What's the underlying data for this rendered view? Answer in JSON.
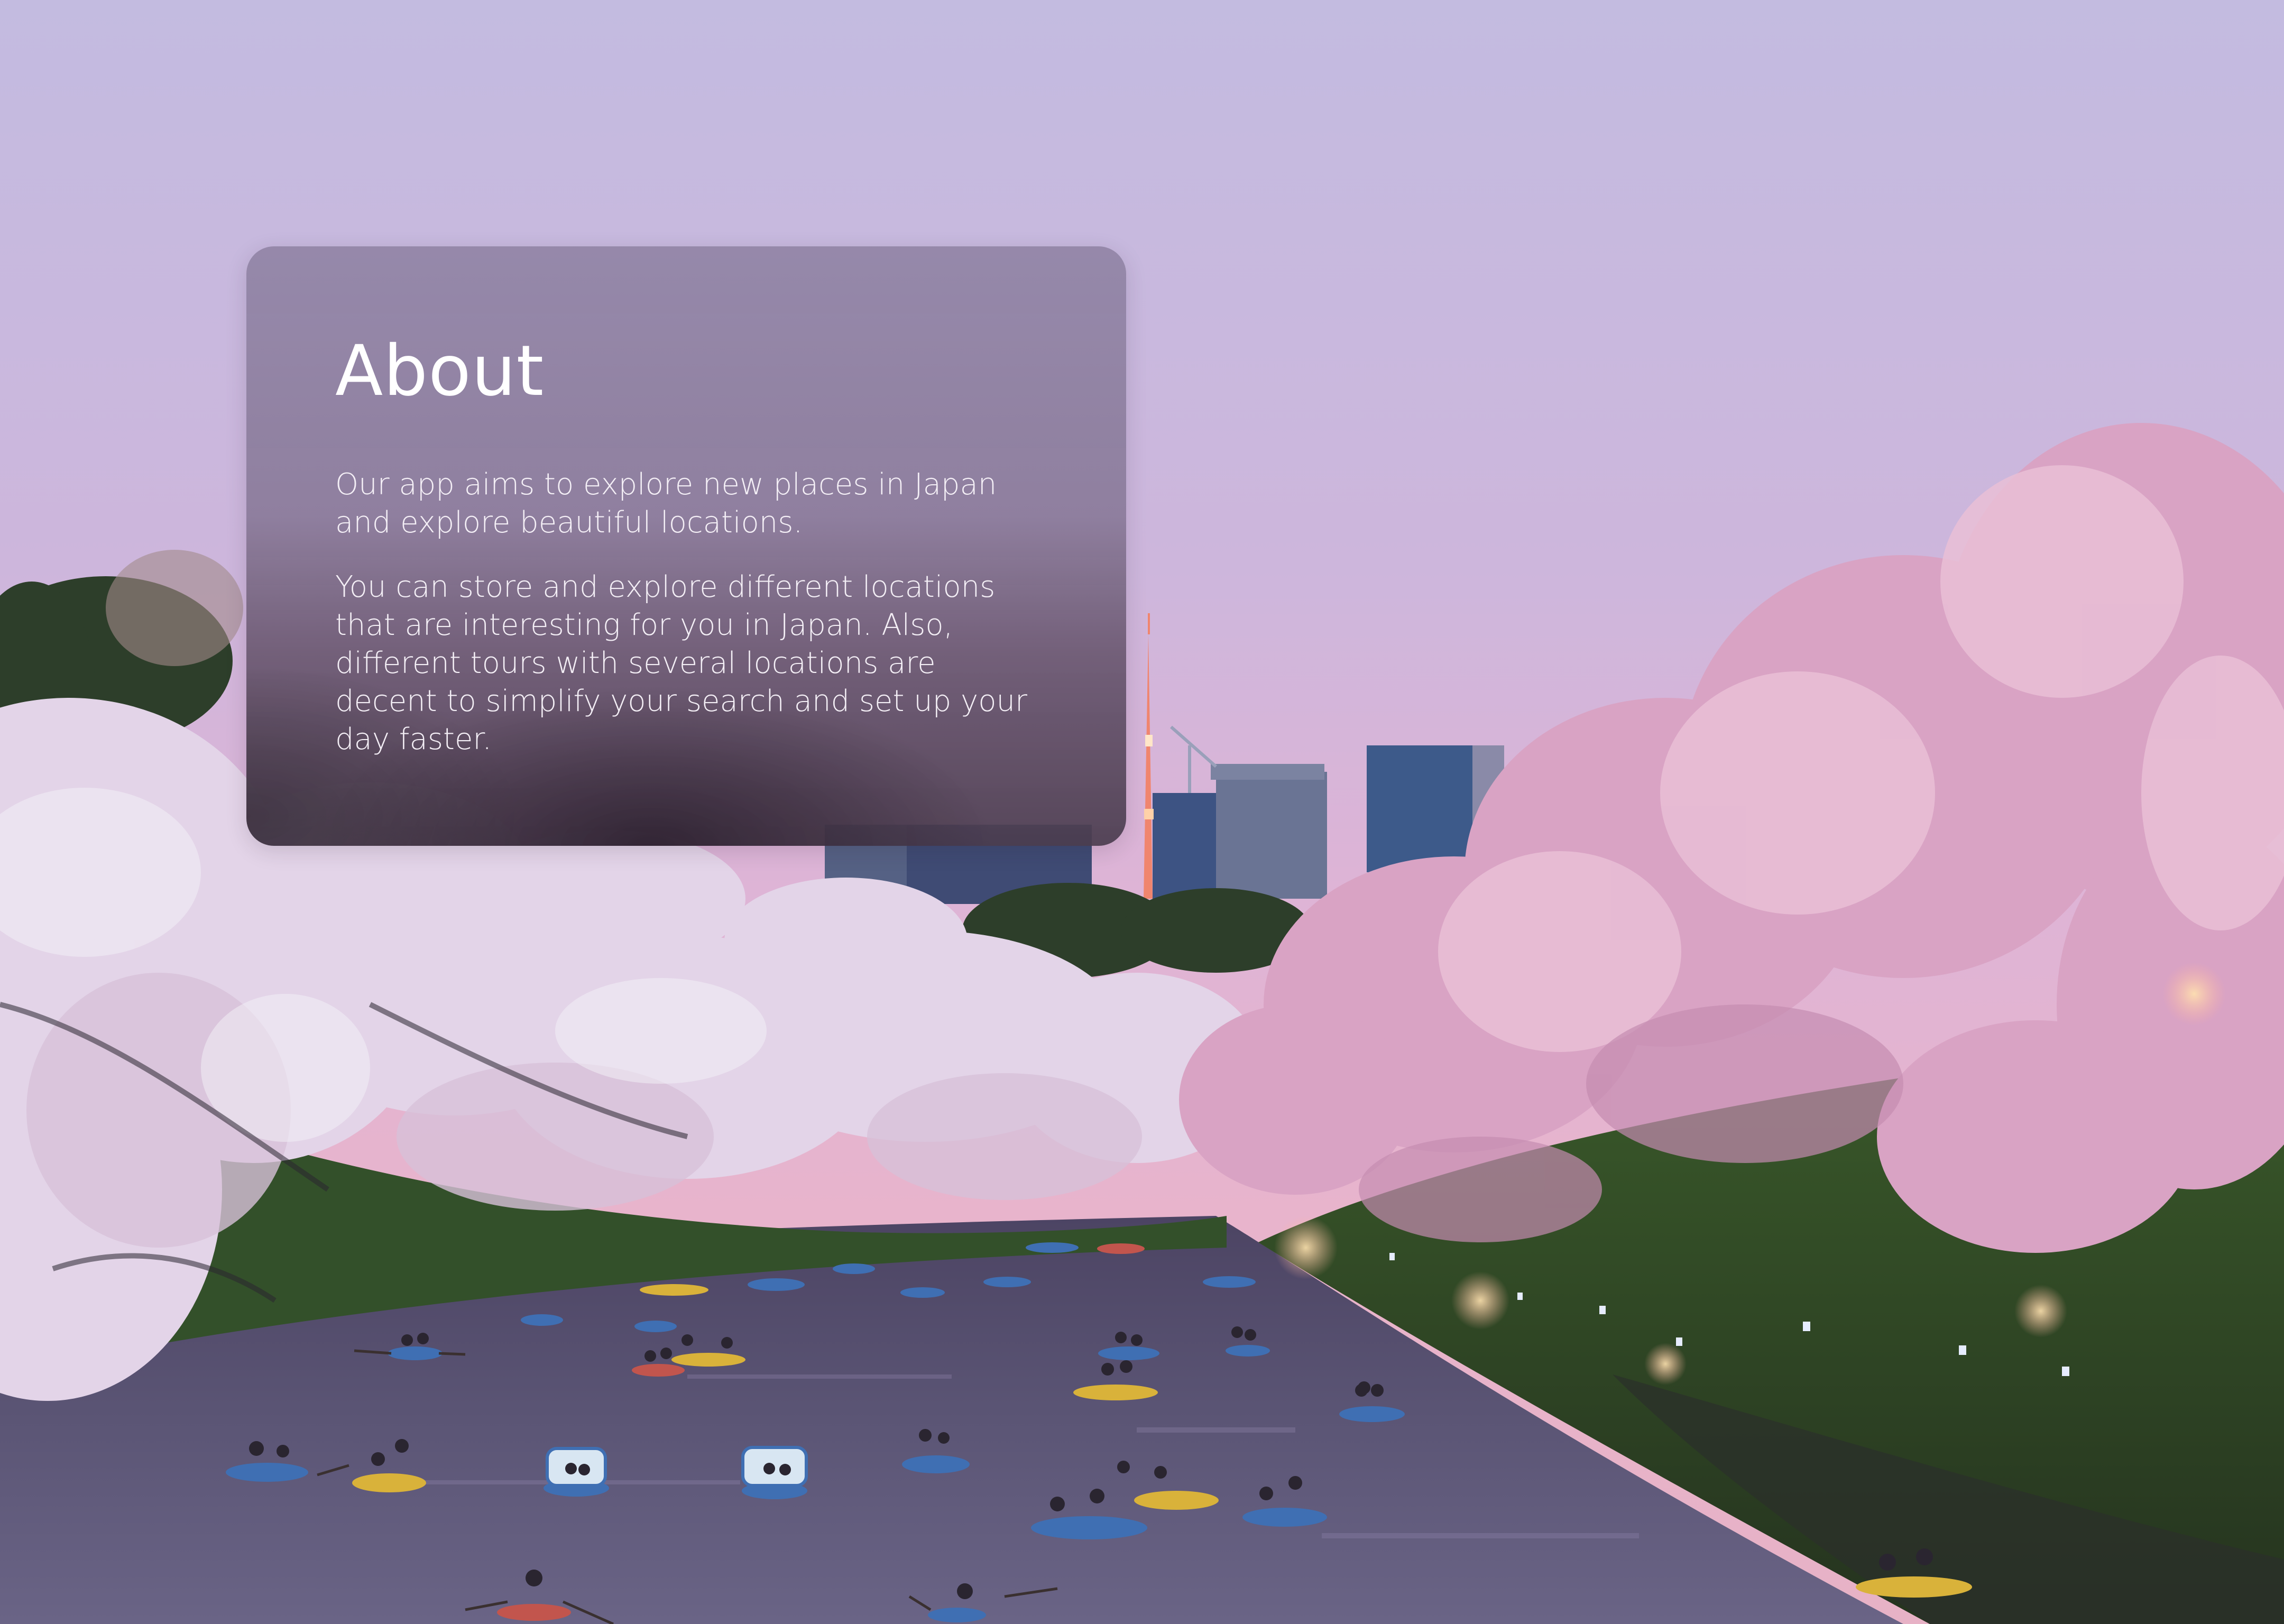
{
  "about": {
    "title": "About",
    "paragraph_1": "Our app aims to explore new places in Japan and explore beautiful locations.",
    "paragraph_2": "You can store and explore different locations that are interesting for you in Japan. Also, different tours with several locations are decent to simplify your search and set up your day faster."
  },
  "background": {
    "description_icon": "cherry-blossom-canal-photo",
    "colors": {
      "sky_top": "#c6bde2",
      "sky_mid": "#d3b6d6",
      "sky_low": "#e6b4cf",
      "blossom": "#e8c8df",
      "blossom_pink": "#e29bb6",
      "water": "#3d3550",
      "grass": "#355d2a",
      "boat_blue": "#3f6fb3",
      "boat_yellow": "#d9b23a"
    }
  }
}
